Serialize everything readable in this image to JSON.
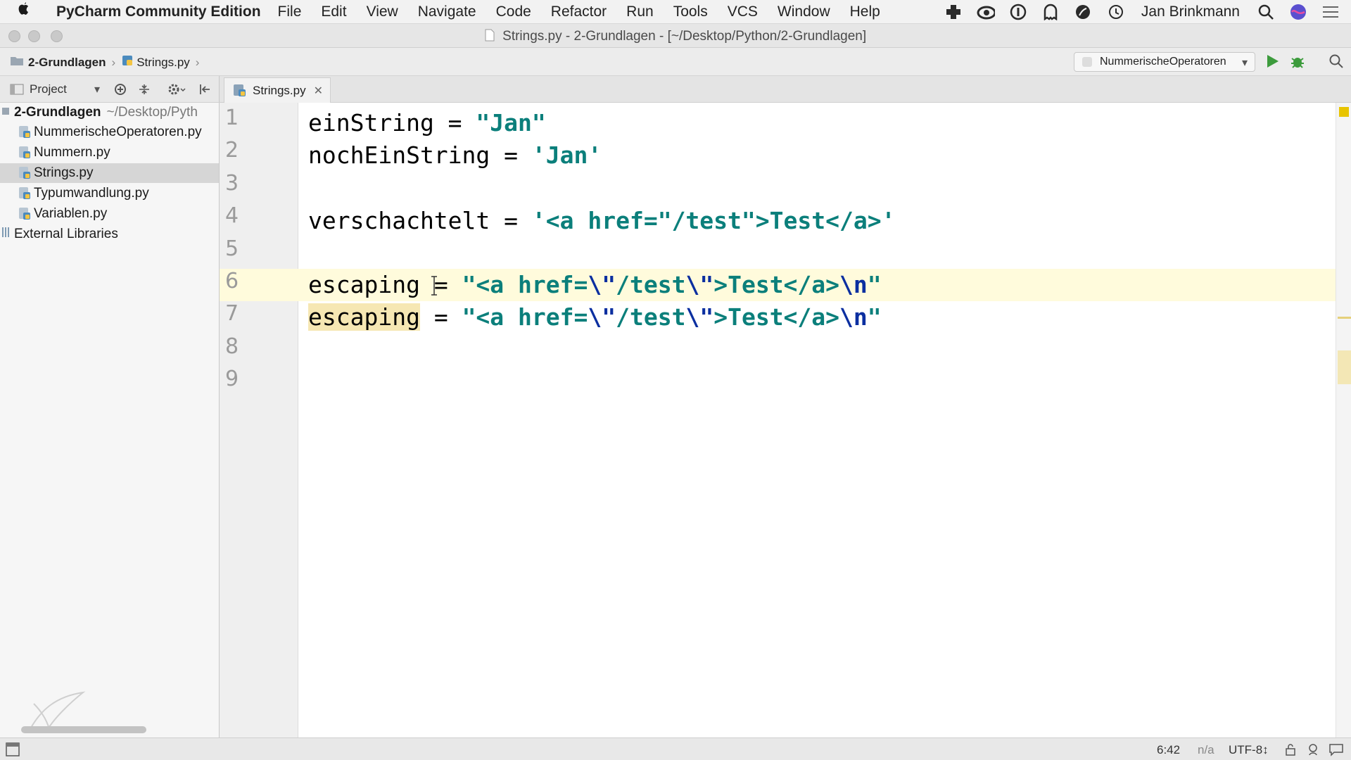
{
  "menubar": {
    "app_name": "PyCharm Community Edition",
    "items": [
      "File",
      "Edit",
      "View",
      "Navigate",
      "Code",
      "Refactor",
      "Run",
      "Tools",
      "VCS",
      "Window",
      "Help"
    ],
    "username": "Jan Brinkmann",
    "status_icons": [
      "plus-cross-icon",
      "creative-cloud-icon",
      "info-icon",
      "ghost-icon",
      "leaf-icon",
      "time-machine-icon"
    ]
  },
  "window": {
    "title": "Strings.py - 2-Grundlagen - [~/Desktop/Python/2-Grundlagen]"
  },
  "breadcrumb": {
    "folder": "2-Grundlagen",
    "file": "Strings.py"
  },
  "toolbar": {
    "run_config": "NummerischeOperatoren"
  },
  "project_panel": {
    "label": "Project",
    "root_name": "2-Grundlagen",
    "root_path": "~/Desktop/Pyth",
    "files": [
      "NummerischeOperatoren.py",
      "Nummern.py",
      "Strings.py",
      "Typumwandlung.py",
      "Variablen.py"
    ],
    "selected_file": "Strings.py",
    "external": "External Libraries"
  },
  "editor": {
    "tab_label": "Strings.py",
    "line_numbers": [
      "1",
      "2",
      "3",
      "4",
      "5",
      "6",
      "7",
      "8",
      "9"
    ],
    "lines": {
      "l1_var": "einString",
      "l1_op": " = ",
      "l1_str": "\"Jan\"",
      "l2_var": "nochEinString",
      "l2_op": " = ",
      "l2_str": "'Jan'",
      "l4_var": "verschachtelt",
      "l4_op": " = ",
      "l4_str": "'<a href=\"/test\">Test</a>'",
      "l6_var": "escaping",
      "l6_op": " = ",
      "l6_s1": "\"<a href=",
      "l6_e1": "\\\"",
      "l6_s2": "/test",
      "l6_e2": "\\\"",
      "l6_s3": ">Test</a>",
      "l6_e3": "\\n",
      "l6_s4": "\"",
      "l7_var": "escaping",
      "l7_op": " = ",
      "l7_s1": "\"<a href=",
      "l7_e1": "\\\"",
      "l7_s2": "/test",
      "l7_e2": "\\\"",
      "l7_s3": ">Test</a>",
      "l7_e3": "\\n",
      "l7_s4": "\""
    }
  },
  "statusbar": {
    "position": "6:42",
    "na": "n/a",
    "encoding": "UTF-8↕"
  },
  "colors": {
    "string": "#0b7f7b",
    "escape": "#0b2fa0",
    "current_line": "#fffbdc",
    "selection_highlight": "#f6e7b3",
    "run_green": "#3c9b3c"
  }
}
